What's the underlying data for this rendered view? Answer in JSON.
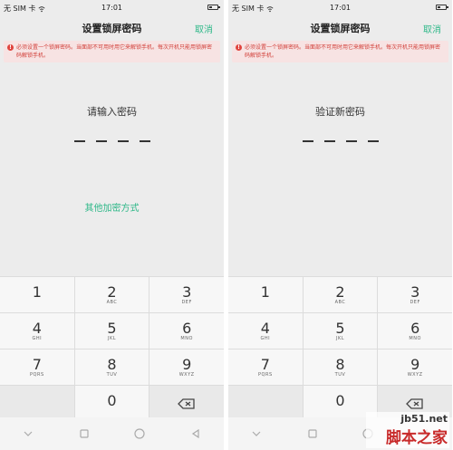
{
  "status_bar": {
    "carrier": "无 SIM 卡",
    "time": "17:01",
    "battery_level": 0.25
  },
  "colors": {
    "accent": "#2fb889",
    "warning": "#d2403a",
    "warning_bg": "#f7e3e3"
  },
  "screens": [
    {
      "title": "设置锁屏密码",
      "cancel_label": "取消",
      "warning": "必须设置一个锁屏密码。当面部不可用时用它来解锁手机。每次开机只能用锁屏密码解锁手机。",
      "prompt": "请输入密码",
      "alt_method": "其他加密方式",
      "pin_length": 4
    },
    {
      "title": "设置锁屏密码",
      "cancel_label": "取消",
      "warning": "必须设置一个锁屏密码。当面部不可用时用它来解锁手机。每次开机只能用锁屏密码解锁手机。",
      "prompt": "验证新密码",
      "pin_length": 4
    }
  ],
  "keypad": {
    "k1": {
      "num": "1",
      "letters": ""
    },
    "k2": {
      "num": "2",
      "letters": "ABC"
    },
    "k3": {
      "num": "3",
      "letters": "DEF"
    },
    "k4": {
      "num": "4",
      "letters": "GHI"
    },
    "k5": {
      "num": "5",
      "letters": "JKL"
    },
    "k6": {
      "num": "6",
      "letters": "MNO"
    },
    "k7": {
      "num": "7",
      "letters": "PQRS"
    },
    "k8": {
      "num": "8",
      "letters": "TUV"
    },
    "k9": {
      "num": "9",
      "letters": "WXYZ"
    },
    "k0": {
      "num": "0",
      "letters": ""
    }
  },
  "icons": {
    "wifi": "wifi-icon",
    "battery": "battery-icon",
    "warning": "warning-icon",
    "delete": "backspace-icon",
    "back": "chevron-down-icon",
    "recent": "square-icon",
    "home": "circle-icon",
    "nav_back": "triangle-back-icon"
  },
  "watermark": {
    "site": "jb51.net",
    "brand": "脚本之家"
  }
}
